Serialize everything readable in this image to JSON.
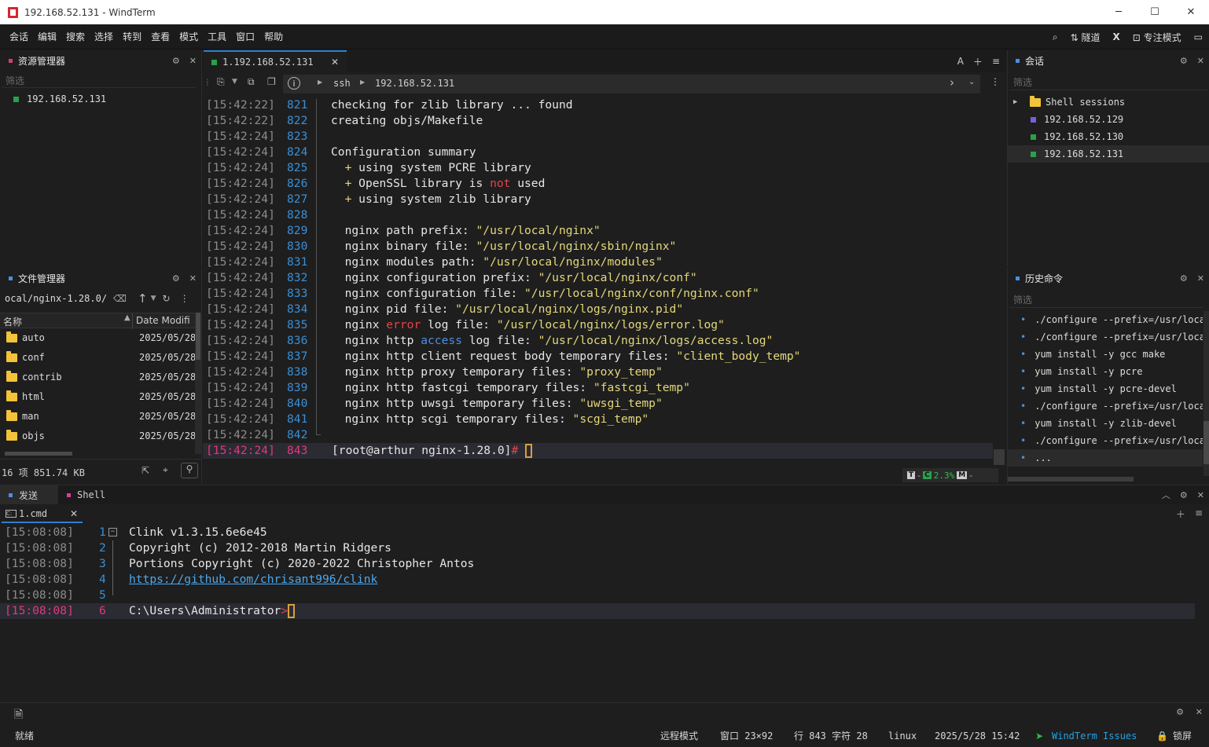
{
  "window": {
    "title": "192.168.52.131 - WindTerm",
    "buttons": [
      "─",
      "☐",
      "✕"
    ]
  },
  "menu": {
    "items": [
      "会话",
      "编辑",
      "搜索",
      "选择",
      "转到",
      "查看",
      "模式",
      "工具",
      "窗口",
      "帮助"
    ],
    "tunnel": "隧道",
    "focus_mode": "专注模式"
  },
  "explorer": {
    "title": "资源管理器",
    "filter": "筛选",
    "items": [
      "192.168.52.131"
    ]
  },
  "file_manager": {
    "title": "文件管理器",
    "path": "ocal/nginx-1.28.0/",
    "columns": [
      "名称",
      "Date Modifi"
    ],
    "rows": [
      {
        "name": "auto",
        "date": "2025/05/28"
      },
      {
        "name": "conf",
        "date": "2025/05/28"
      },
      {
        "name": "contrib",
        "date": "2025/05/28"
      },
      {
        "name": "html",
        "date": "2025/05/28"
      },
      {
        "name": "man",
        "date": "2025/05/28"
      },
      {
        "name": "objs",
        "date": "2025/05/28"
      }
    ],
    "summary": "16 项  851.74 KB"
  },
  "terminal": {
    "tab_label": "1.192.168.52.131",
    "tab_tools": "A",
    "breadcrumb": [
      "ssh",
      "192.168.52.131"
    ],
    "status": {
      "t": "T",
      "c": "C",
      "percent": "2.3%",
      "m": "M"
    }
  },
  "sessions": {
    "title": "会话",
    "filter": "筛选",
    "group": "Shell sessions",
    "items": [
      {
        "label": "192.168.52.129",
        "color": "#7a5ce0"
      },
      {
        "label": "192.168.52.130",
        "color": "#2aa04a"
      },
      {
        "label": "192.168.52.131",
        "color": "#2aa04a"
      }
    ]
  },
  "history": {
    "title": "历史命令",
    "filter": "筛选",
    "items": [
      "./configure --prefix=/usr/local",
      "./configure --prefix=/usr/local",
      "yum install -y gcc make",
      "yum install -y pcre",
      "yum install -y pcre-devel",
      "./configure --prefix=/usr/local",
      "yum install -y zlib-devel",
      "./configure --prefix=/usr/local",
      "..."
    ]
  },
  "bottom": {
    "tabs": [
      "发送",
      "Shell"
    ],
    "doc_tab": "1.cmd",
    "lines": [
      {
        "ts": "[15:08:08]",
        "ln": "1",
        "text": "Clink v1.3.15.6e6e45"
      },
      {
        "ts": "[15:08:08]",
        "ln": "2",
        "text": "Copyright (c) 2012-2018 Martin Ridgers"
      },
      {
        "ts": "[15:08:08]",
        "ln": "3",
        "text": "Portions Copyright (c) 2020-2022 Christopher Antos"
      },
      {
        "ts": "[15:08:08]",
        "ln": "4",
        "text": "https://github.com/chrisant996/clink"
      },
      {
        "ts": "[15:08:08]",
        "ln": "5",
        "text": ""
      },
      {
        "ts": "[15:08:08]",
        "ln": "6",
        "text": "C:\\Users\\Administrator>"
      }
    ]
  },
  "statusbar": {
    "ready": "就绪",
    "remote_mode": "远程模式",
    "window_size": "窗口 23×92",
    "position": "行 843 字符 28",
    "os": "linux",
    "datetime": "2025/5/28 15:42",
    "issues": "WindTerm Issues",
    "lock": "锁屏"
  }
}
